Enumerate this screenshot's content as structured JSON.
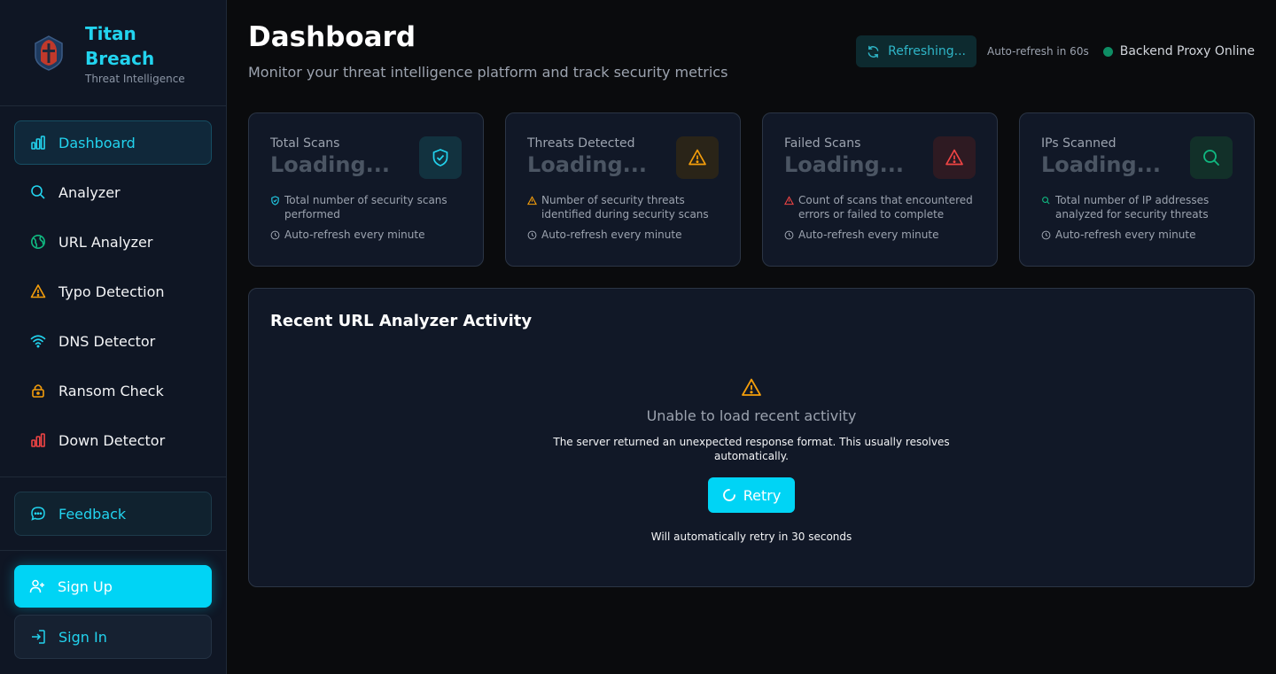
{
  "brand": {
    "name": "Titan Breach",
    "subtitle": "Threat Intelligence"
  },
  "nav": {
    "items": [
      {
        "label": "Dashboard",
        "icon": "bar-chart-icon",
        "active": true
      },
      {
        "label": "Analyzer",
        "icon": "search-icon"
      },
      {
        "label": "URL Analyzer",
        "icon": "globe-icon"
      },
      {
        "label": "Typo Detection",
        "icon": "warning-icon"
      },
      {
        "label": "DNS Detector",
        "icon": "wifi-icon"
      },
      {
        "label": "Ransom Check",
        "icon": "lock-icon"
      },
      {
        "label": "Down Detector",
        "icon": "bar-chart-icon"
      }
    ],
    "feedback": "Feedback",
    "signup": "Sign Up",
    "signin": "Sign In"
  },
  "header": {
    "title": "Dashboard",
    "subtitle": "Monitor your threat intelligence platform and track security metrics",
    "refresh_label": "Refreshing...",
    "auto_refresh": "Auto-refresh in 60s",
    "backend_status": "Backend Proxy Online"
  },
  "cards": [
    {
      "title": "Total Scans",
      "value": "Loading...",
      "desc": "Total number of security scans performed",
      "refresh": "Auto-refresh every minute",
      "accent": "#22d3ee",
      "icon": "shield-check-icon"
    },
    {
      "title": "Threats Detected",
      "value": "Loading...",
      "desc": "Number of security threats identified during security scans",
      "refresh": "Auto-refresh every minute",
      "accent": "#f59e0b",
      "icon": "warning-icon"
    },
    {
      "title": "Failed Scans",
      "value": "Loading...",
      "desc": "Count of scans that encountered errors or failed to complete",
      "refresh": "Auto-refresh every minute",
      "accent": "#ef4444",
      "icon": "alert-triangle-icon"
    },
    {
      "title": "IPs Scanned",
      "value": "Loading...",
      "desc": "Total number of IP addresses analyzed for security threats",
      "refresh": "Auto-refresh every minute",
      "accent": "#10b981",
      "icon": "search-icon"
    }
  ],
  "activity": {
    "title": "Recent URL Analyzer Activity",
    "error_title": "Unable to load recent activity",
    "error_message": "The server returned an unexpected response format. This usually resolves automatically.",
    "retry_label": "Retry",
    "retry_note": "Will automatically retry in 30 seconds"
  }
}
